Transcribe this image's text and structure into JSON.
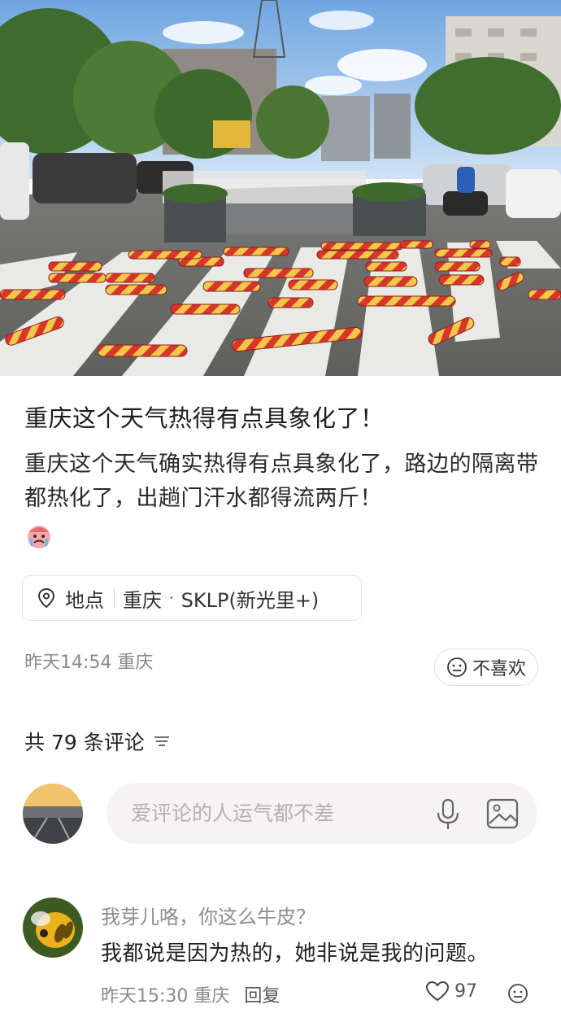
{
  "post": {
    "title": "重庆这个天气热得有点具象化了！",
    "body": "重庆这个天气确实热得有点具象化了，路边的隔离带都热化了，出趟门汗水都得流两斤！",
    "emoji": "crying-emoji"
  },
  "location": {
    "label": "地点",
    "city": "重庆",
    "dot": "·",
    "place": "SKLP(新光里+)"
  },
  "meta": {
    "time_city": "昨天14:54 重庆",
    "dislike_label": "不喜欢"
  },
  "comments": {
    "header": "共 79 条评论",
    "input_placeholder": "爱评论的人运气都不差",
    "items": [
      {
        "user": "我芽儿咯，你这么牛皮？",
        "text": "我都说是因为热的，她非说是我的问题。",
        "time_city": "昨天15:30 重庆",
        "reply_label": "回复",
        "likes": "97"
      }
    ]
  },
  "colors": {
    "bollard_red": "#d9362b",
    "bollard_yellow": "#f2c84b",
    "road": "#6f6f6f",
    "input_bg": "#f6f3f4"
  }
}
